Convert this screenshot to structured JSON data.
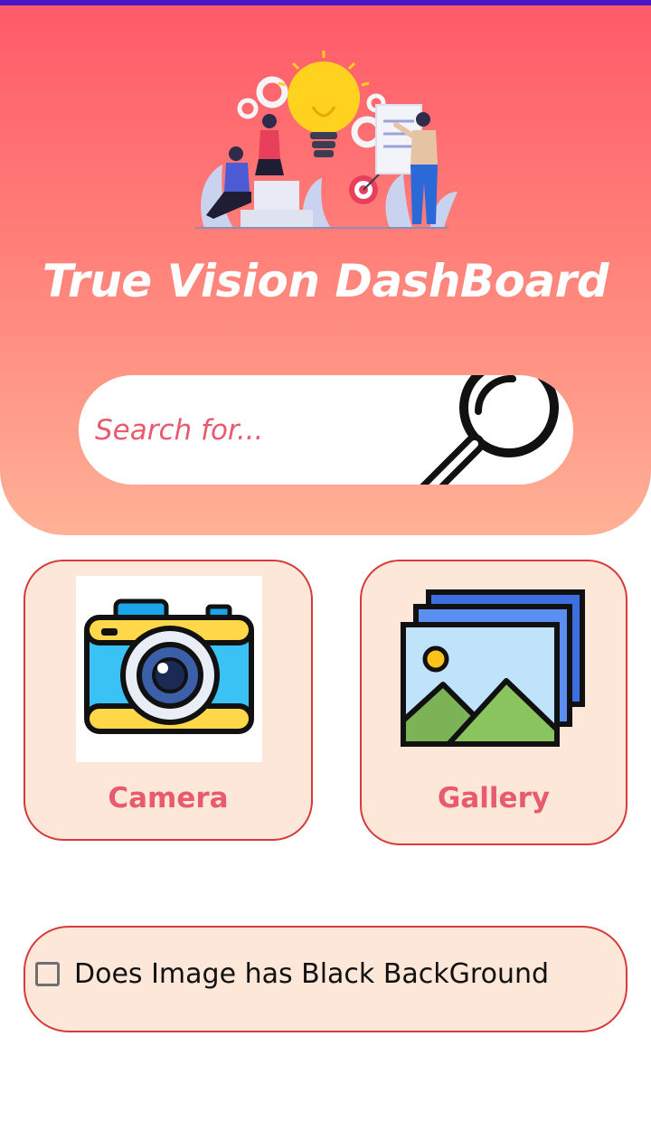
{
  "app": {
    "title": "True Vision DashBoard"
  },
  "search": {
    "placeholder": "Search for..."
  },
  "tiles": [
    {
      "label": "Camera",
      "icon": "camera-icon"
    },
    {
      "label": "Gallery",
      "icon": "gallery-icon"
    }
  ],
  "option": {
    "label": "Does Image has Black BackGround",
    "checked": false
  },
  "colors": {
    "header_top": "#ff5a69",
    "header_bottom": "#ffb196",
    "accent_text": "#e85a6d",
    "tile_bg": "#fde7d9",
    "tile_border": "#d63a3a",
    "status_bar": "#4a16c9"
  }
}
